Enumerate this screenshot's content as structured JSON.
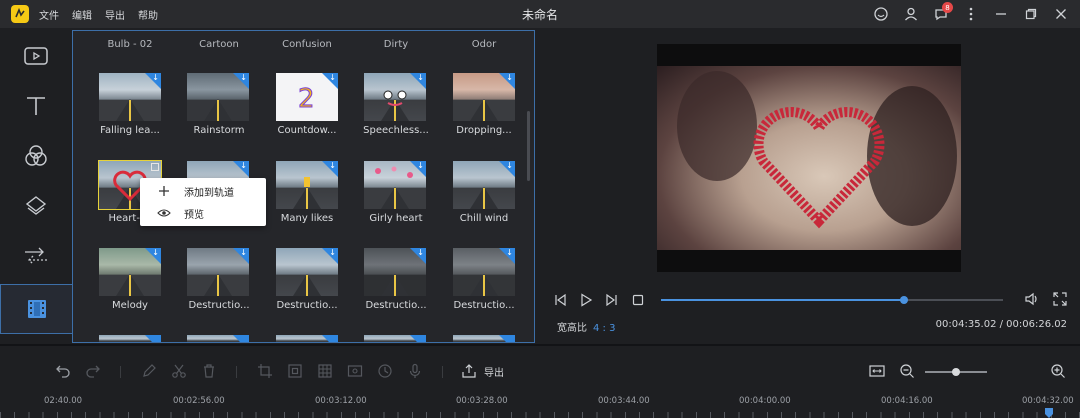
{
  "app": {
    "title": "未命名",
    "menu": [
      "文件",
      "编辑",
      "导出",
      "帮助"
    ],
    "notification_count": "8"
  },
  "library": {
    "category_row": [
      "Bulb - 02",
      "Cartoon",
      "Confusion",
      "Dirty",
      "Odor"
    ],
    "rows": [
      [
        "Falling lea...",
        "Rainstorm",
        "Countdow...",
        "Speechless...",
        "Dropping..."
      ],
      [
        "Heart-sh",
        "",
        "Many likes",
        "Girly heart",
        "Chill wind"
      ],
      [
        "Melody",
        "Destructio...",
        "Destructio...",
        "Destructio...",
        "Destructio..."
      ]
    ]
  },
  "context_menu": {
    "items": [
      {
        "label": "添加到轨道",
        "icon": "plus-icon"
      },
      {
        "label": "预览",
        "icon": "eye-icon"
      }
    ]
  },
  "player": {
    "progress": 0.71,
    "aspect_label": "宽高比",
    "aspect_value": "4 : 3",
    "timecode": "00:04:35.02 / 00:06:26.02"
  },
  "toolbar": {
    "export_label": "导出",
    "zoom_level": 0.5
  },
  "timeline": {
    "ticks": [
      "02:40.00",
      "00:02:56.00",
      "00:03:12.00",
      "00:03:28.00",
      "00:03:44.00",
      "00:04:00.00",
      "00:04:16.00",
      "00:04:32.00"
    ]
  },
  "colors": {
    "accent": "#4a92e0",
    "selection": "#e6d23a",
    "logo": "#f6c915"
  }
}
